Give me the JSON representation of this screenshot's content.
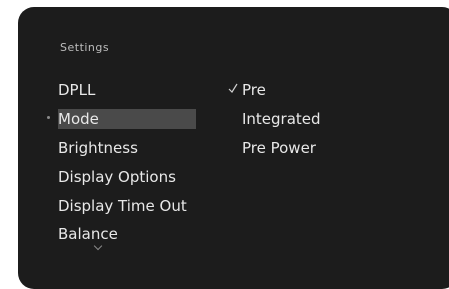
{
  "screen": {
    "title": "Settings"
  },
  "menu": {
    "items": [
      {
        "label": "DPLL"
      },
      {
        "label": "Mode"
      },
      {
        "label": "Brightness"
      },
      {
        "label": "Display Options"
      },
      {
        "label": "Display Time Out"
      },
      {
        "label": "Balance"
      }
    ],
    "selected_index": 1
  },
  "mode_options": {
    "items": [
      {
        "label": "Pre",
        "checked": true
      },
      {
        "label": "Integrated",
        "checked": false
      },
      {
        "label": "Pre Power",
        "checked": false
      }
    ]
  },
  "icons": {
    "selection_marker": "dot-icon",
    "check": "checkmark-icon",
    "more": "chevron-down-icon"
  }
}
